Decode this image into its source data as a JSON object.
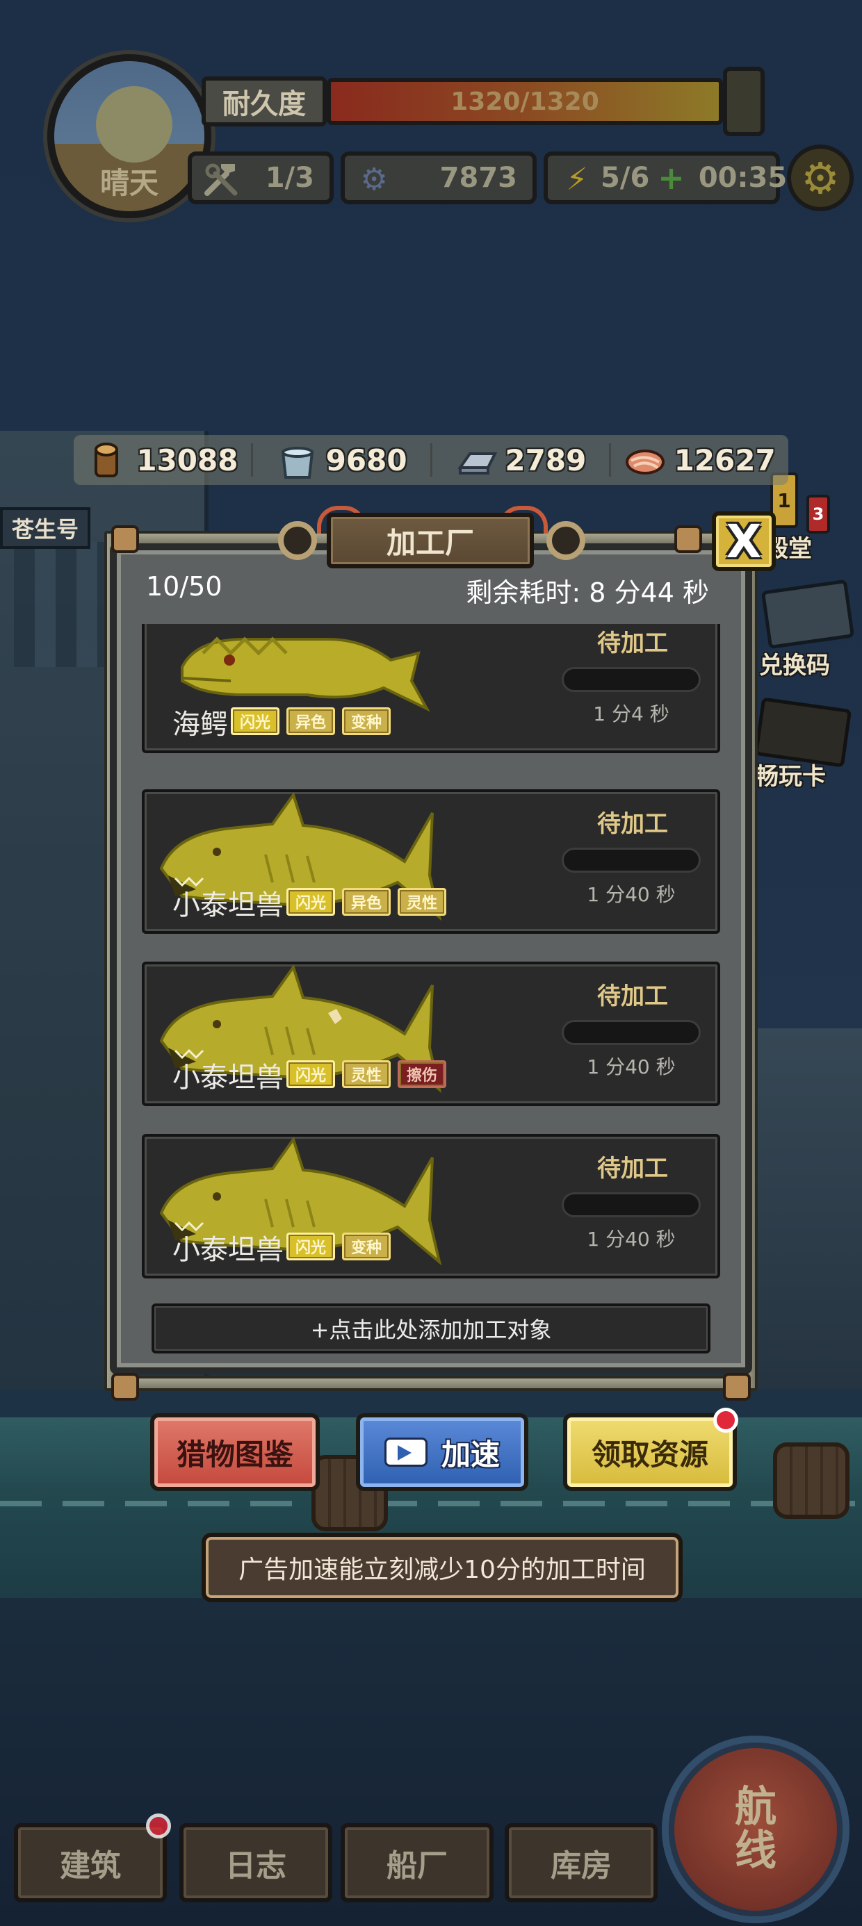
{
  "hud": {
    "weather": "晴天",
    "durability_label": "耐久度",
    "durability_text": "1320/1320",
    "durability_fraction": 1.0,
    "tools": "1/3",
    "gears": "7873",
    "energy": "5/6",
    "energy_plus": "+",
    "energy_timer": "00:35"
  },
  "resources": [
    {
      "icon": "wood-log-icon",
      "value": "13088"
    },
    {
      "icon": "water-bucket-icon",
      "value": "9680"
    },
    {
      "icon": "iron-ingot-icon",
      "value": "2789"
    },
    {
      "icon": "meat-icon",
      "value": "12627"
    }
  ],
  "background_labels": {
    "ship_name": "苍生号",
    "hall": "殿堂",
    "redeem": "兑换码",
    "pass": "畅玩卡",
    "badge_1": "1",
    "badge_3": "3"
  },
  "panel": {
    "title": "加工厂",
    "close": "X",
    "count": "10/50",
    "remaining": "剩余耗时: 8 分44 秒",
    "add_target": "+点击此处添加加工对象"
  },
  "items": [
    {
      "name": "海鳄",
      "status": "待加工",
      "time": "1 分4 秒",
      "tags": [
        {
          "text": "闪光",
          "kind": "gold"
        },
        {
          "text": "异色",
          "kind": "normal"
        },
        {
          "text": "变种",
          "kind": "normal"
        }
      ]
    },
    {
      "name": "小泰坦兽",
      "status": "待加工",
      "time": "1 分40 秒",
      "tags": [
        {
          "text": "闪光",
          "kind": "gold"
        },
        {
          "text": "异色",
          "kind": "normal"
        },
        {
          "text": "灵性",
          "kind": "normal"
        }
      ]
    },
    {
      "name": "小泰坦兽",
      "status": "待加工",
      "time": "1 分40 秒",
      "tags": [
        {
          "text": "闪光",
          "kind": "gold"
        },
        {
          "text": "灵性",
          "kind": "normal"
        },
        {
          "text": "擦伤",
          "kind": "red"
        }
      ]
    },
    {
      "name": "小泰坦兽",
      "status": "待加工",
      "time": "1 分40 秒",
      "tags": [
        {
          "text": "闪光",
          "kind": "gold"
        },
        {
          "text": "变种",
          "kind": "normal"
        }
      ]
    }
  ],
  "actions": {
    "catalog": "猎物图鉴",
    "speedup": "加速",
    "collect": "领取资源"
  },
  "tip": "广告加速能立刻减少10分的加工时间",
  "nav": {
    "build": "建筑",
    "log": "日志",
    "shipyard": "船厂",
    "warehouse": "库房",
    "route": "航线"
  },
  "colors": {
    "accent_gold": "#d5b33a",
    "status_gold": "#e0c889",
    "danger_red": "#e0283a",
    "speed_blue": "#2f5fb0"
  }
}
